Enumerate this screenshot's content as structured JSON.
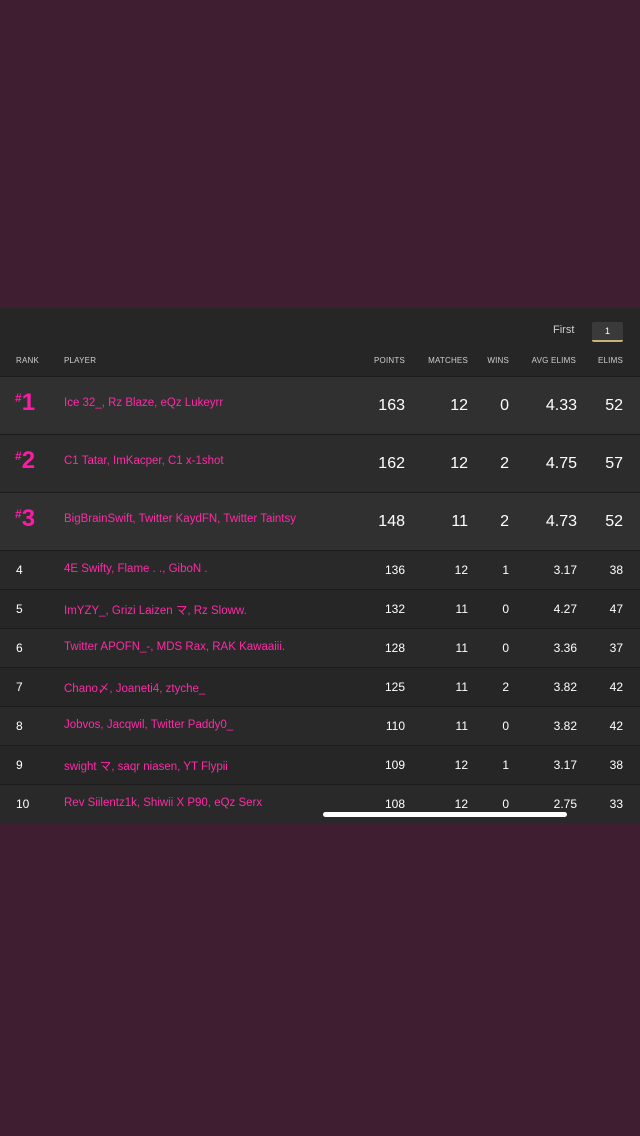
{
  "pagination": {
    "first_label": "First",
    "current_page": "1"
  },
  "columns": {
    "rank": "RANK",
    "player": "PLAYER",
    "points": "POINTS",
    "matches": "MATCHES",
    "wins": "WINS",
    "avg_elims": "AVG ELIMS",
    "elims": "ELIMS"
  },
  "rank_prefix": "#",
  "rows": [
    {
      "rank": "1",
      "players": "Ice 32_, Rz Blaze, eQz Lukeyrr",
      "points": "163",
      "matches": "12",
      "wins": "0",
      "avg_elims": "4.33",
      "elims": "52"
    },
    {
      "rank": "2",
      "players": "C1 Tatar, ImKacper, C1 x-1shot",
      "points": "162",
      "matches": "12",
      "wins": "2",
      "avg_elims": "4.75",
      "elims": "57"
    },
    {
      "rank": "3",
      "players": "BigBrainSwift, Twitter KaydFN, Twitter Taintsy",
      "points": "148",
      "matches": "11",
      "wins": "2",
      "avg_elims": "4.73",
      "elims": "52"
    },
    {
      "rank": "4",
      "players": "4E Swifty, Flame . ., GiboN .",
      "points": "136",
      "matches": "12",
      "wins": "1",
      "avg_elims": "3.17",
      "elims": "38"
    },
    {
      "rank": "5",
      "players": "ImYZY_, Grizi Laizen マ, Rz Sloww.",
      "points": "132",
      "matches": "11",
      "wins": "0",
      "avg_elims": "4.27",
      "elims": "47"
    },
    {
      "rank": "6",
      "players": "Twitter APOFN_-, MDS Rax, RAK Kawaaiii.",
      "points": "128",
      "matches": "11",
      "wins": "0",
      "avg_elims": "3.36",
      "elims": "37"
    },
    {
      "rank": "7",
      "players": "Chano〆, Joaneti4, ztyche_",
      "points": "125",
      "matches": "11",
      "wins": "2",
      "avg_elims": "3.82",
      "elims": "42"
    },
    {
      "rank": "8",
      "players": "Jobvos, Jacqwil, Twitter Paddy0_",
      "points": "110",
      "matches": "11",
      "wins": "0",
      "avg_elims": "3.82",
      "elims": "42"
    },
    {
      "rank": "9",
      "players": "swight マ, saqr niasen, YT Flypii",
      "points": "109",
      "matches": "12",
      "wins": "1",
      "avg_elims": "3.17",
      "elims": "38"
    },
    {
      "rank": "10",
      "players": "Rev Siilentz1k, Shiwii X P90, eQz Serx",
      "points": "108",
      "matches": "12",
      "wins": "0",
      "avg_elims": "2.75",
      "elims": "33"
    }
  ],
  "colors": {
    "background": "#3f1e31",
    "table_background": "#262626",
    "player_text": "#ff2aa8",
    "rank_badge": "#ff1aa6",
    "active_page_underline": "#c9b27a"
  }
}
